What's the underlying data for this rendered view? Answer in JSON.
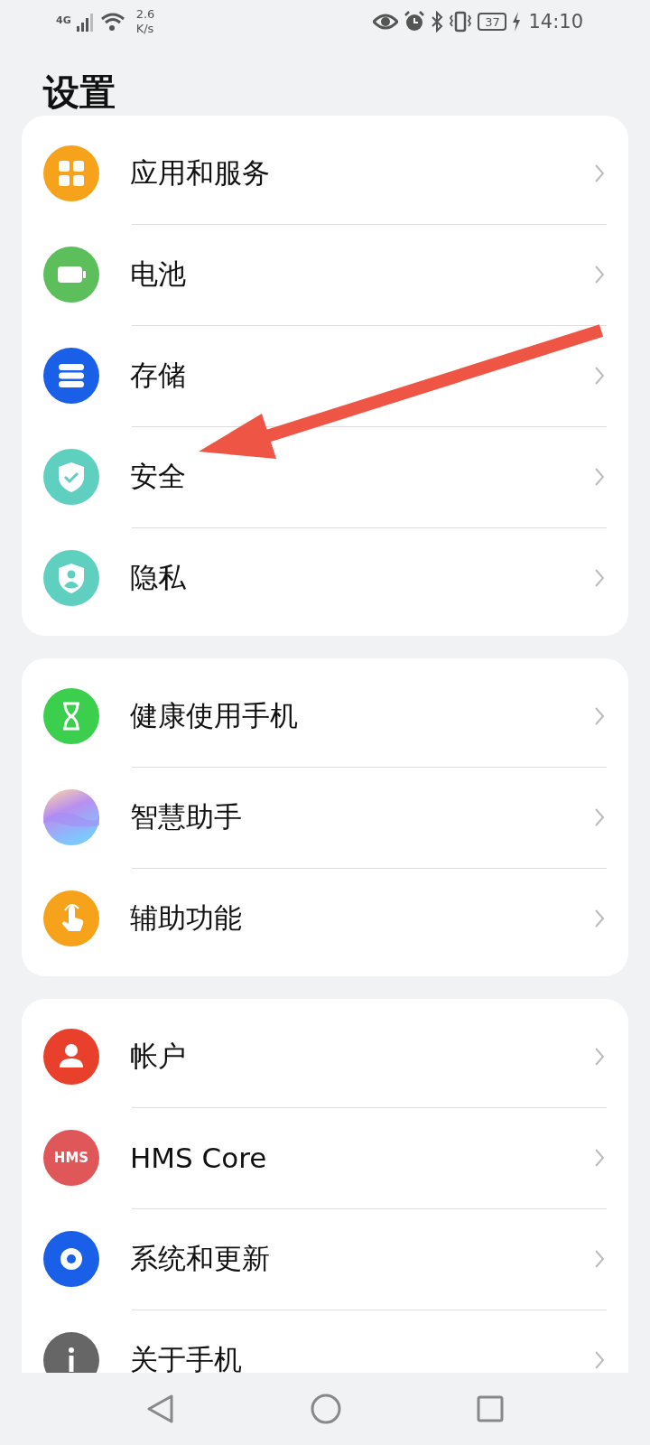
{
  "status_bar": {
    "network": "4G",
    "speed_value": "2.6",
    "speed_unit": "K/s",
    "battery": "37",
    "time": "14:10"
  },
  "title": "设置",
  "groups": [
    {
      "items": [
        {
          "label": "应用和服务",
          "color": "#f7a21b"
        },
        {
          "label": "电池",
          "color": "#5cbf5c"
        },
        {
          "label": "存储",
          "color": "#1a5fe8"
        },
        {
          "label": "安全",
          "color": "#5fd0c0"
        },
        {
          "label": "隐私",
          "color": "#5fd0c0"
        }
      ]
    },
    {
      "items": [
        {
          "label": "健康使用手机",
          "color": "#3ccf4e"
        },
        {
          "label": "智慧助手",
          "color": "#b98ff0"
        },
        {
          "label": "辅助功能",
          "color": "#f7a21b"
        }
      ]
    },
    {
      "items": [
        {
          "label": "帐户",
          "color": "#e8402a"
        },
        {
          "label": "HMS Core",
          "color": "#e0575a",
          "icon_text": "HMS"
        },
        {
          "label": "系统和更新",
          "color": "#1a5fe8"
        },
        {
          "label": "关于手机",
          "color": "#666666"
        }
      ]
    }
  ]
}
